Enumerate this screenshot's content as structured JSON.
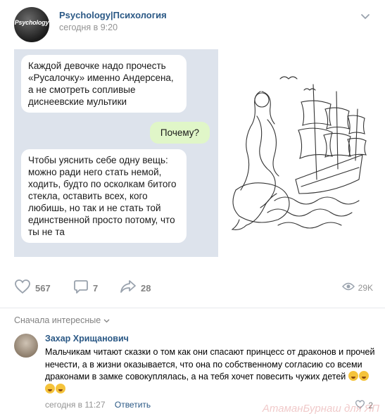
{
  "post": {
    "avatar_text": "Psychology",
    "author": "Psychology|Психология",
    "time": "сегодня в 9:20"
  },
  "image": {
    "message1": "Каждой девочке надо прочесть «Русалочку» именно Андерсена, а не смотреть сопливые диснеевские мультики",
    "message2": "Почему?",
    "message3": "Чтобы уяснить себе одну вещь: можно ради него стать немой, ходить, будто по осколкам битого стекла, оставить всех, кого любишь, но так и не стать той единственной просто потому, что ты не та"
  },
  "actions": {
    "likes": "567",
    "comments": "7",
    "shares": "28",
    "views": "29K"
  },
  "comments": {
    "sort_label": "Сначала интересные",
    "items": [
      {
        "author": "Захар Хрищанович",
        "text": "Мальчикам читают сказки о том как они спасают принцесс от драконов и прочей нечести, а в жизни оказывается, что она по собственному согласию со всеми драконами в замке совокуплялась, а на тебя хочет повесить чужих детей",
        "time": "сегодня в 11:27",
        "reply_label": "Ответить",
        "likes": "2"
      }
    ]
  },
  "watermark": "АтаманБурнаш для ЯП",
  "colors": {
    "link": "#2a5885",
    "meta": "#939393",
    "chat_bg": "#dde3ec",
    "own_bubble": "#e0f6c8"
  }
}
